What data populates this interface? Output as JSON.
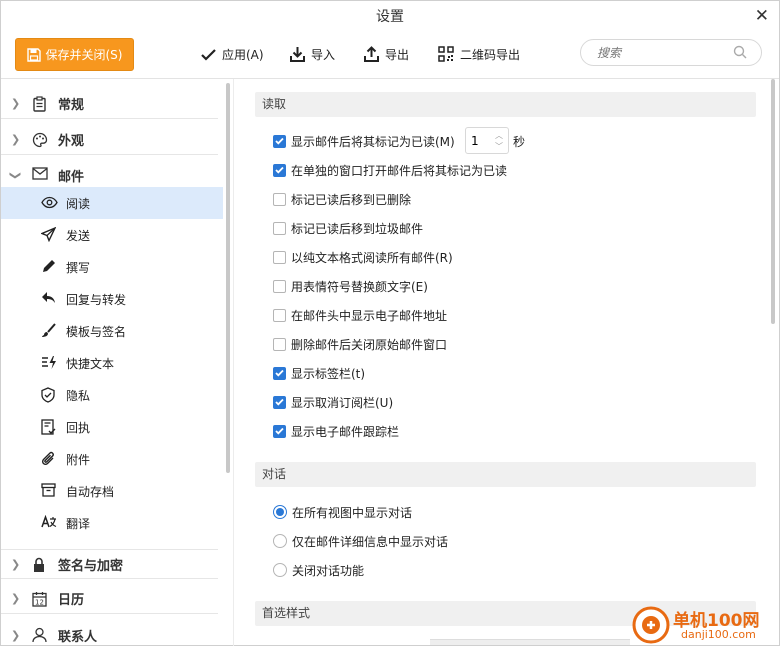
{
  "window": {
    "title": "设置"
  },
  "toolbar": {
    "save_label": "保存并关闭(S)",
    "apply_label": "应用(A)",
    "import_label": "导入",
    "export_label": "导出",
    "qr_export_label": "二维码导出",
    "search_placeholder": "搜索"
  },
  "sidebar": {
    "groups": [
      {
        "label": "常规",
        "icon": "clipboard-icon",
        "expanded": false
      },
      {
        "label": "外观",
        "icon": "palette-icon",
        "expanded": false
      },
      {
        "label": "邮件",
        "icon": "envelope-icon",
        "expanded": true
      },
      {
        "label": "签名与加密",
        "icon": "lock-icon",
        "expanded": false
      },
      {
        "label": "日历",
        "icon": "calendar-icon",
        "expanded": false
      },
      {
        "label": "联系人",
        "icon": "person-icon",
        "expanded": false
      }
    ],
    "items": [
      {
        "label": "阅读",
        "icon": "eye-icon",
        "selected": true
      },
      {
        "label": "发送",
        "icon": "send-icon"
      },
      {
        "label": "撰写",
        "icon": "pen-icon"
      },
      {
        "label": "回复与转发",
        "icon": "reply-icon"
      },
      {
        "label": "模板与签名",
        "icon": "brush-icon"
      },
      {
        "label": "快捷文本",
        "icon": "quicktext-icon"
      },
      {
        "label": "隐私",
        "icon": "shield-icon"
      },
      {
        "label": "回执",
        "icon": "receipt-icon"
      },
      {
        "label": "附件",
        "icon": "paperclip-icon"
      },
      {
        "label": "自动存档",
        "icon": "archive-icon"
      },
      {
        "label": "翻译",
        "icon": "translate-icon"
      }
    ]
  },
  "content": {
    "reading": {
      "header": "读取",
      "mark_read_seconds": "1",
      "seconds_unit": "秒",
      "options": [
        {
          "label": "显示邮件后将其标记为已读(M)",
          "checked": true
        },
        {
          "label": "在单独的窗口打开邮件后将其标记为已读",
          "checked": true
        },
        {
          "label": "标记已读后移到已删除",
          "checked": false
        },
        {
          "label": "标记已读后移到垃圾邮件",
          "checked": false
        },
        {
          "label": "以纯文本格式阅读所有邮件(R)",
          "checked": false
        },
        {
          "label": "用表情符号替换颜文字(E)",
          "checked": false
        },
        {
          "label": "在邮件头中显示电子邮件地址",
          "checked": false
        },
        {
          "label": "删除邮件后关闭原始邮件窗口",
          "checked": false
        },
        {
          "label": "显示标签栏(t)",
          "checked": true
        },
        {
          "label": "显示取消订阅栏(U)",
          "checked": true
        },
        {
          "label": "显示电子邮件跟踪栏",
          "checked": true
        }
      ]
    },
    "conversation": {
      "header": "对话",
      "options": [
        {
          "label": "在所有视图中显示对话",
          "selected": true
        },
        {
          "label": "仅在邮件详细信息中显示对话",
          "selected": false
        },
        {
          "label": "关闭对话功能",
          "selected": false
        }
      ]
    },
    "style": {
      "header": "首选样式"
    }
  },
  "watermark": {
    "text": "单机100网",
    "url": "danji100.com"
  },
  "colors": {
    "accent": "#2a78d6",
    "save_button": "#f7971e",
    "selection": "#dceafb"
  }
}
